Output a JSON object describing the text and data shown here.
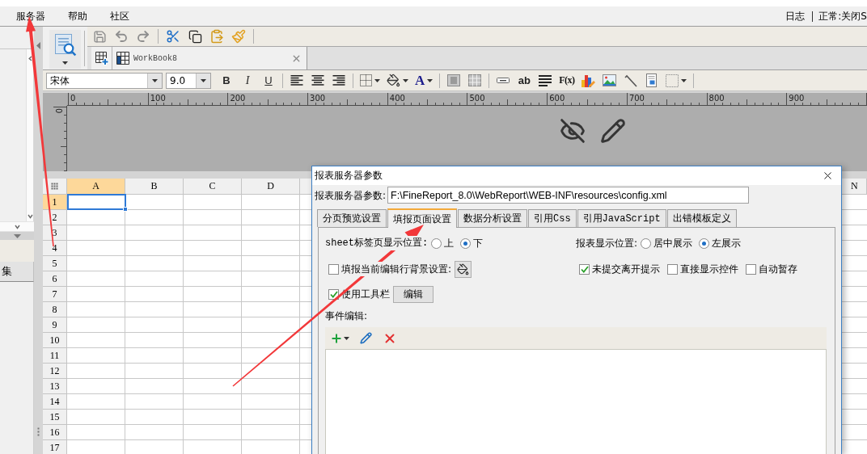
{
  "menu_bar": {
    "items": [
      "服务器",
      "帮助",
      "社区"
    ],
    "log_link": "日志",
    "status": "正常:关闭S"
  },
  "left_panel": {
    "tab_label": "集"
  },
  "quick_toolbar": {
    "groups": [
      [
        {
          "kind": "save",
          "disabled": true
        },
        {
          "kind": "undo",
          "disabled": true
        },
        {
          "kind": "redo",
          "disabled": true
        }
      ],
      [
        {
          "kind": "cut",
          "disabled": false
        },
        {
          "kind": "copy",
          "disabled": false
        },
        {
          "kind": "paste",
          "disabled": false
        },
        {
          "kind": "format-painter",
          "disabled": false
        }
      ]
    ]
  },
  "document_tabs": [
    {
      "label": "WorkBook8",
      "selected": true
    }
  ],
  "format_toolbar": {
    "font": "宋体",
    "size": "9.0",
    "bold": "B",
    "italic": "I",
    "underline": "U",
    "font_color": "A",
    "text_widget": "ab",
    "formula": "F(x)"
  },
  "ruler": {
    "horizontal_labels": [
      "0",
      "100",
      "200",
      "300",
      "400",
      "500",
      "600",
      "700",
      "800",
      "900"
    ],
    "vertical_labels": [
      "0"
    ]
  },
  "spreadsheet": {
    "columns": [
      {
        "label": "A",
        "selected": true
      },
      {
        "label": "B",
        "selected": false
      },
      {
        "label": "C",
        "selected": false
      },
      {
        "label": "D",
        "selected": false
      }
    ],
    "columns_right": [
      {
        "label": "N",
        "selected": false
      }
    ],
    "rows": [
      {
        "label": "1",
        "selected": true
      },
      {
        "label": "2",
        "selected": false
      },
      {
        "label": "3",
        "selected": false
      },
      {
        "label": "4",
        "selected": false
      },
      {
        "label": "5",
        "selected": false
      },
      {
        "label": "6",
        "selected": false
      },
      {
        "label": "7",
        "selected": false
      },
      {
        "label": "8",
        "selected": false
      },
      {
        "label": "9",
        "selected": false
      },
      {
        "label": "10",
        "selected": false
      },
      {
        "label": "11",
        "selected": false
      },
      {
        "label": "12",
        "selected": false
      },
      {
        "label": "13",
        "selected": false
      },
      {
        "label": "14",
        "selected": false
      },
      {
        "label": "15",
        "selected": false
      },
      {
        "label": "16",
        "selected": false
      },
      {
        "label": "17",
        "selected": false
      }
    ]
  },
  "dialog": {
    "title": "报表服务器参数",
    "path_label": "报表服务器参数:",
    "path_value": "F:\\FineReport_8.0\\WebReport\\WEB-INF\\resources\\config.xml",
    "tabs": [
      {
        "label": "分页预览设置",
        "selected": false
      },
      {
        "label": "填报页面设置",
        "selected": true
      },
      {
        "label": "数据分析设置",
        "selected": false
      },
      {
        "label": "引用Css",
        "selected": false
      },
      {
        "label": "引用JavaScript",
        "selected": false
      },
      {
        "label": "出错模板定义",
        "selected": false
      }
    ],
    "sheet_position": {
      "label": "sheet标签页显示位置:",
      "options": [
        {
          "label": "上",
          "selected": false
        },
        {
          "label": "下",
          "selected": true
        }
      ]
    },
    "report_position": {
      "label": "报表显示位置:",
      "options": [
        {
          "label": "居中展示",
          "selected": false
        },
        {
          "label": "左展示",
          "selected": true
        }
      ]
    },
    "row_highlight": {
      "label": "填报当前编辑行背景设置:",
      "checked": false
    },
    "options": [
      {
        "label": "未提交离开提示",
        "checked": true
      },
      {
        "label": "直接显示控件",
        "checked": false
      },
      {
        "label": "自动暂存",
        "checked": false
      }
    ],
    "toolbar_option": {
      "label": "使用工具栏",
      "checked": true
    },
    "toolbar_button": "编辑",
    "events_label": "事件编辑:"
  }
}
